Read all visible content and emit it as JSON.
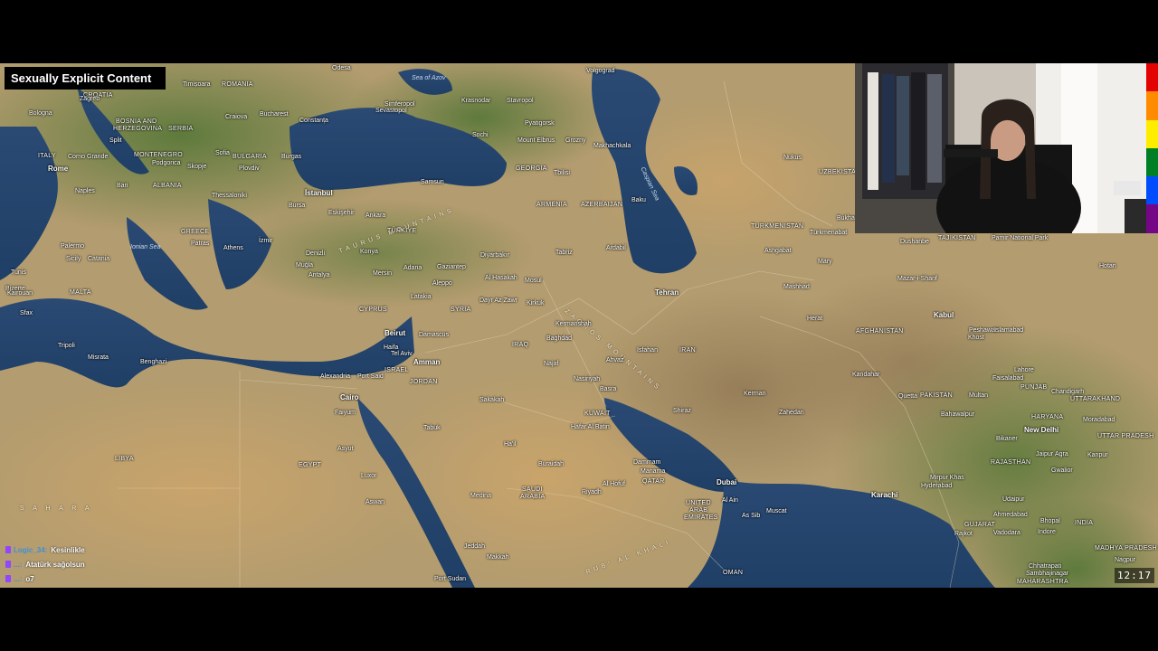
{
  "content_warning": "Sexually Explicit Content",
  "clock": "12:17",
  "pride_colors": [
    "#e40303",
    "#ff8c00",
    "#ffed00",
    "#008026",
    "#004dff",
    "#750787"
  ],
  "chat": [
    {
      "user": "Logic_34:",
      "message": "Kesinlikle"
    },
    {
      "user": "...:",
      "message": "Atatürk sağolsun"
    },
    {
      "user": "...:",
      "message": "o7"
    }
  ],
  "map_labels": {
    "odesa": "Odesa",
    "sea_of_azov": "Sea of Azov",
    "krasnodar": "Krasnodar",
    "stavropol": "Stavropol",
    "volgograd": "Volgograd",
    "timisoara": "Timișoara",
    "croatia": "CROATIA",
    "romania": "ROMANIA",
    "zagreb": "Zagreb",
    "bologna": "Bologna",
    "bosnia": "BOSNIA AND",
    "herzegovina": "HERZEGOVINA",
    "serbia": "SERBIA",
    "craiova": "Craiova",
    "bucharest": "Bucharest",
    "constanta": "Constanța",
    "simferopol": "Simferopol",
    "sevastopol": "Sevastopol",
    "split": "Split",
    "montenegro": "MONTENEGRO",
    "sofia": "Sofia",
    "bulgaria": "BULGARIA",
    "burgas": "Burgas",
    "sochi": "Sochi",
    "mount_elbrus": "Mount Elbrus",
    "pyatigorsk": "Pyatigorsk",
    "grozny": "Grozny",
    "makhachkala": "Makhachkala",
    "nukus": "Nukus",
    "uzbekistan": "UZBEKISTAN",
    "italy": "ITALY",
    "rome": "Rome",
    "campo": "Corno Grande",
    "podgorica": "Podgorica",
    "skopje": "Skopje",
    "plovdiv": "Plovdiv",
    "istanbul": "İstanbul",
    "samsun": "Samsun",
    "georgia": "GEORGIA",
    "tbilisi": "Tbilisi",
    "caspian_sea": "Caspian Sea",
    "bari": "Bari",
    "albania": "ALBANIA",
    "thessaloniki": "Thessaloniki",
    "bursa": "Bursa",
    "eskisehir": "Eskişehir",
    "ankara": "Ankara",
    "armenia": "ARMENIA",
    "azerbaijan": "AZERBAIJAN",
    "baku": "Baku",
    "turkmenistan": "TURKMENISTAN",
    "turkmenabat": "Türkmenabat",
    "bukhara": "Bukhara",
    "dushanbe": "Dushanbe",
    "tajikistan": "TAJIKISTAN",
    "pamir": "Pamir National Park",
    "naples": "Naples",
    "greece": "GREECE",
    "izmir": "İzmir",
    "turkiye": "TÜRKİYE",
    "konya": "Konya",
    "diyarbakir": "Diyarbakır",
    "tabriz": "Tabriz",
    "ardabil": "Ardabil",
    "ashgabat": "Ashgabat",
    "mary": "Mary",
    "hotan": "Hotan",
    "palermo": "Palermo",
    "ionian_sea": "Ionian Sea",
    "patras": "Patras",
    "athens": "Athens",
    "denizli": "Denizli",
    "mugla": "Muğla",
    "antalya": "Antalya",
    "taurus_mountains": "TAURUS MOUNTAINS",
    "adana": "Adana",
    "gaziantep": "Gaziantep",
    "mersin": "Mersin",
    "mosul": "Mosul",
    "al_hasakah": "Al Hasakah",
    "mazar": "Mazar-i-Sharif",
    "bizerte": "Bizerte",
    "tunis": "Tunis",
    "sicily": "Sicily",
    "catania": "Catania",
    "malta": "MALTA",
    "aleppo": "Aleppo",
    "latakia": "Latakia",
    "dayr": "Dayr Az Zawr",
    "kirkuk": "Kirkuk",
    "tehran": "Tehran",
    "mashhad": "Mashhad",
    "kabul": "Kabul",
    "kairouan": "Kairouan",
    "sfax": "Sfax",
    "cyprus": "CYPRUS",
    "syria": "SYRIA",
    "zagros_mountains": "ZAGROS MOUNTAINS",
    "kermanshah": "Kermanshah",
    "herat": "Herat",
    "peshawar": "Peshawar",
    "islamabad": "Islamabad",
    "beirut": "Beirut",
    "damascus": "Damascus",
    "haifa": "Haifa",
    "iraq": "IRAQ",
    "baghdad": "Baghdad",
    "isfahan": "Isfahan",
    "iran": "IRAN",
    "afghanistan": "AFGHANISTAN",
    "khost": "Khost",
    "tripoli": "Tripoli",
    "misrata": "Misrata",
    "benghazi": "Benghazi",
    "tel_aviv": "Tel Aviv",
    "amman": "Amman",
    "israel": "ISRAEL",
    "jordan": "JORDAN",
    "najaf": "Najaf",
    "ahvaz": "Ahvaz",
    "kandahar": "Kandahar",
    "lahore": "Lahore",
    "faisalabad": "Faisalabad",
    "punjab": "PUNJAB",
    "alexandria": "Alexandria",
    "port_said": "Port Said",
    "nasiriyah": "Nasiriyah",
    "basra": "Basra",
    "kerman": "Kerman",
    "quetta": "Quetta",
    "pakistan": "PAKISTAN",
    "multan": "Multan",
    "chandigarh": "Chandigarh",
    "uttarakhand": "UTTARAKHAND",
    "cairo": "Cairo",
    "sakakah": "Sakakah",
    "kuwait": "KUWAIT",
    "shiraz": "Shiraz",
    "zahedan": "Zahedan",
    "bahawalpur": "Bahawalpur",
    "haryana": "HARYANA",
    "moradabad": "Moradabad",
    "faiyum": "Faiyum",
    "hafar": "Hafar Al Batin",
    "tabuk": "Tabuk",
    "new_delhi": "New Delhi",
    "libya": "LIBYA",
    "hail": "Ha'il",
    "bikaner": "Bikaner",
    "uttar_pradesh": "UTTAR PRADESH",
    "asyut": "Asyut",
    "egypt": "EGYPT",
    "buraidah": "Buraidah",
    "dammam": "Dammam",
    "manama": "Manama",
    "jaipur": "Jaipur",
    "agra": "Agra",
    "kanpur": "Kanpur",
    "rajasthan": "RAJASTHAN",
    "gwalior": "Gwalior",
    "luxor": "Luxor",
    "qatar": "QATAR",
    "dubai": "Dubai",
    "mirpur": "Mirpur Khas",
    "hyderabad": "Hyderabad",
    "medina": "Medina",
    "saudi": "SAUDI",
    "arabia": "ARABIA",
    "riyadh": "Riyadh",
    "al_hofuf": "Al Hofuf",
    "al_ain": "Al Ain",
    "udaipur": "Udaipur",
    "aswan": "Aswan",
    "karachi": "Karachi",
    "united": "UNITED",
    "arab": "ARAB",
    "emirates": "EMIRATES",
    "muscat": "Muscat",
    "as_sib": "As Sib",
    "ahmedabad": "Ahmedabad",
    "india": "INDIA",
    "bhopal": "Bhopal",
    "gujarat": "GUJARAT",
    "indore": "Indore",
    "vadodara": "Vadodara",
    "madhya": "MADHYA PRADESH",
    "rajkot": "Rajkot",
    "jeddah": "Jeddah",
    "makkah": "Makkah",
    "oman": "OMAN",
    "port_sudan": "Port Sudan",
    "nagpur": "Nagpur",
    "chhatrapati": "Chhatrapati",
    "sambhajinagar": "Sambhajinagar",
    "maharashtra": "MAHARASHTRA",
    "sahara": "S A H A R A",
    "rub_al_khali": "RUB' AL KHALI"
  }
}
